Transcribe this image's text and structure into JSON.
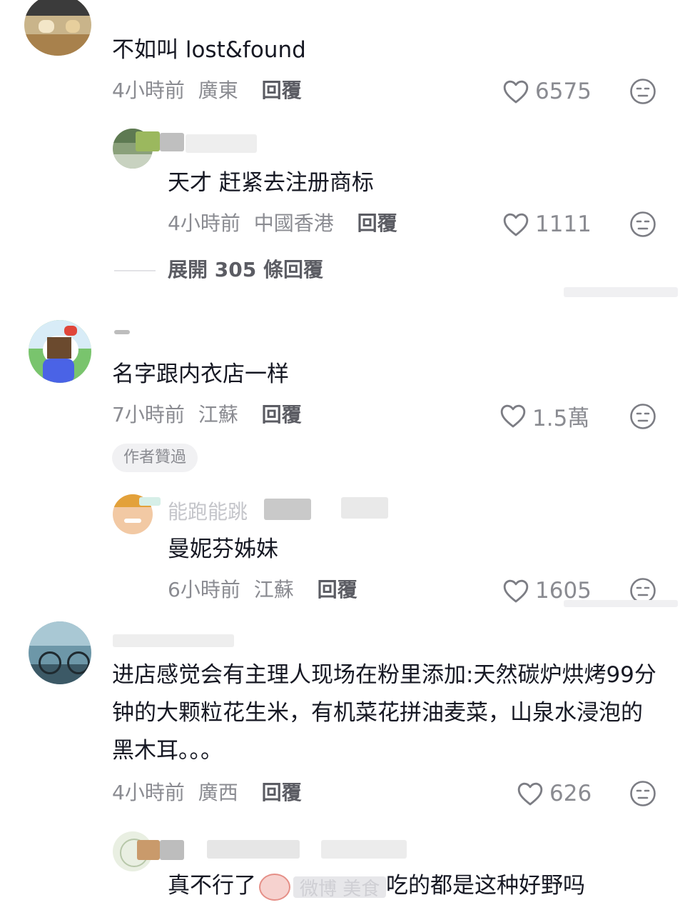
{
  "comments": [
    {
      "text": "不如叫 lost&found",
      "time": "4小時前",
      "location": "廣東",
      "reply_label": "回覆",
      "likes": "6575",
      "replies": [
        {
          "username": "",
          "text": "天才 赶紧去注册商标",
          "time": "4小時前",
          "location": "中國香港",
          "reply_label": "回覆",
          "likes": "1111"
        }
      ],
      "expand_label": "展開 305 條回覆"
    },
    {
      "text": "名字跟内衣店一样",
      "time": "7小時前",
      "location": "江蘇",
      "reply_label": "回覆",
      "likes": "1.5萬",
      "badge": "作者贊過",
      "replies": [
        {
          "username": "能跑能跳",
          "text": "曼妮芬姊妹",
          "time": "6小時前",
          "location": "江蘇",
          "reply_label": "回覆",
          "likes": "1605"
        }
      ]
    },
    {
      "text": "进店感觉会有主理人现场在粉里添加:天然碳炉烘烤99分钟的大颗粒花生米，有机菜花拼油麦菜，山泉水浸泡的黑木耳。。。",
      "time": "4小時前",
      "location": "廣西",
      "reply_label": "回覆",
      "likes": "626",
      "replies": [
        {
          "username": "",
          "text_before": "真不行了",
          "text_after": "吃的都是这种好野吗",
          "watermark": "微博 美食"
        }
      ]
    }
  ],
  "icons": {
    "like": "heart-outline-icon",
    "reaction": "neutral-face-icon"
  },
  "colors": {
    "text": "#161823",
    "meta": "#8a8b91",
    "reply": "#5b5c63",
    "icon": "#7c7d84"
  }
}
